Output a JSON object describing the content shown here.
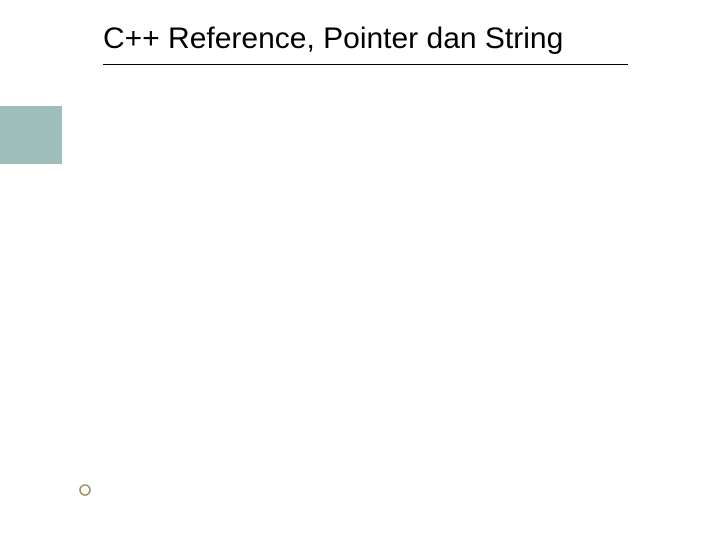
{
  "slide": {
    "title": "C++ Reference, Pointer dan String"
  },
  "colors": {
    "accent": "#9dbeb9",
    "bullet_stroke": "#a28f5a",
    "text": "#000000"
  }
}
